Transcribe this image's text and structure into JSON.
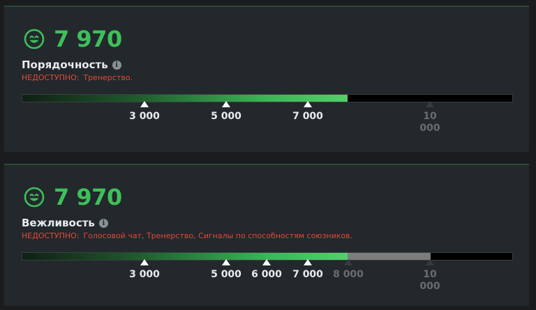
{
  "colors": {
    "score": "#3fbf5a",
    "restriction": "#e04a3a",
    "bar_fill_end": "#52d06a",
    "bar_remaining_grey": "#7d7d7d"
  },
  "panels": [
    {
      "icon": "smiley-face-icon",
      "score": "7 970",
      "title": "Порядочность",
      "restriction_label": "НЕДОСТУПНО:",
      "restriction_text": "Тренерство.",
      "bar": {
        "max": 10000,
        "value": 7970,
        "remaining_grey_to": null
      },
      "ticks": [
        {
          "value": 3000,
          "label": "3 000",
          "dim": false
        },
        {
          "value": 5000,
          "label": "5 000",
          "dim": false
        },
        {
          "value": 7000,
          "label": "7 000",
          "dim": false
        },
        {
          "value": 10000,
          "label": "10 000",
          "dim": true
        }
      ]
    },
    {
      "icon": "smiley-face-icon",
      "score": "7 970",
      "title": "Вежливость",
      "restriction_label": "НЕДОСТУПНО:",
      "restriction_text": "Голосовой чат, Тренерство, Сигналы по способностям союзников.",
      "bar": {
        "max": 10000,
        "value": 7970,
        "remaining_grey_to": 10000
      },
      "ticks": [
        {
          "value": 3000,
          "label": "3 000",
          "dim": false
        },
        {
          "value": 5000,
          "label": "5 000",
          "dim": false
        },
        {
          "value": 6000,
          "label": "6 000",
          "dim": false
        },
        {
          "value": 7000,
          "label": "7 000",
          "dim": false
        },
        {
          "value": 8000,
          "label": "8 000",
          "dim": true
        },
        {
          "value": 10000,
          "label": "10 000",
          "dim": true
        }
      ]
    }
  ]
}
